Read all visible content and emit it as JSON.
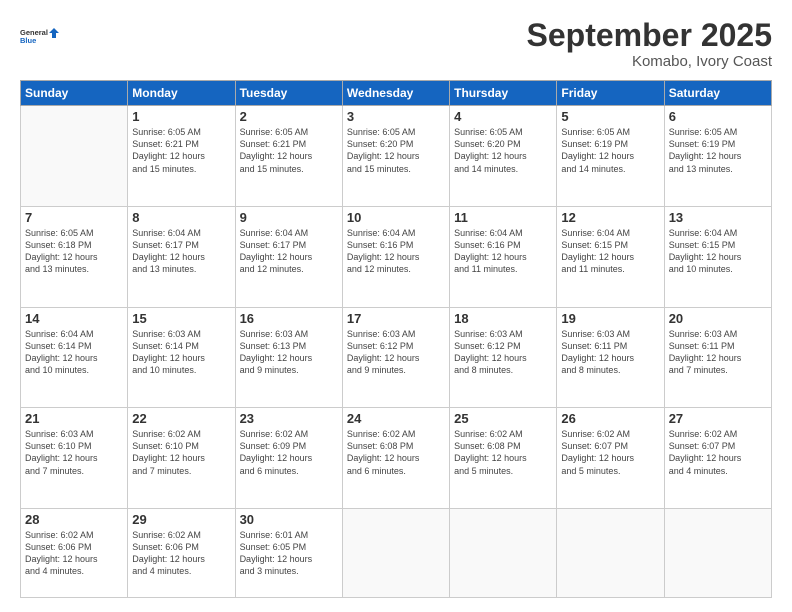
{
  "logo": {
    "line1": "General",
    "line2": "Blue"
  },
  "title": "September 2025",
  "location": "Komabo, Ivory Coast",
  "header_days": [
    "Sunday",
    "Monday",
    "Tuesday",
    "Wednesday",
    "Thursday",
    "Friday",
    "Saturday"
  ],
  "weeks": [
    [
      {
        "day": "",
        "info": ""
      },
      {
        "day": "1",
        "info": "Sunrise: 6:05 AM\nSunset: 6:21 PM\nDaylight: 12 hours\nand 15 minutes."
      },
      {
        "day": "2",
        "info": "Sunrise: 6:05 AM\nSunset: 6:21 PM\nDaylight: 12 hours\nand 15 minutes."
      },
      {
        "day": "3",
        "info": "Sunrise: 6:05 AM\nSunset: 6:20 PM\nDaylight: 12 hours\nand 15 minutes."
      },
      {
        "day": "4",
        "info": "Sunrise: 6:05 AM\nSunset: 6:20 PM\nDaylight: 12 hours\nand 14 minutes."
      },
      {
        "day": "5",
        "info": "Sunrise: 6:05 AM\nSunset: 6:19 PM\nDaylight: 12 hours\nand 14 minutes."
      },
      {
        "day": "6",
        "info": "Sunrise: 6:05 AM\nSunset: 6:19 PM\nDaylight: 12 hours\nand 13 minutes."
      }
    ],
    [
      {
        "day": "7",
        "info": "Sunrise: 6:05 AM\nSunset: 6:18 PM\nDaylight: 12 hours\nand 13 minutes."
      },
      {
        "day": "8",
        "info": "Sunrise: 6:04 AM\nSunset: 6:17 PM\nDaylight: 12 hours\nand 13 minutes."
      },
      {
        "day": "9",
        "info": "Sunrise: 6:04 AM\nSunset: 6:17 PM\nDaylight: 12 hours\nand 12 minutes."
      },
      {
        "day": "10",
        "info": "Sunrise: 6:04 AM\nSunset: 6:16 PM\nDaylight: 12 hours\nand 12 minutes."
      },
      {
        "day": "11",
        "info": "Sunrise: 6:04 AM\nSunset: 6:16 PM\nDaylight: 12 hours\nand 11 minutes."
      },
      {
        "day": "12",
        "info": "Sunrise: 6:04 AM\nSunset: 6:15 PM\nDaylight: 12 hours\nand 11 minutes."
      },
      {
        "day": "13",
        "info": "Sunrise: 6:04 AM\nSunset: 6:15 PM\nDaylight: 12 hours\nand 10 minutes."
      }
    ],
    [
      {
        "day": "14",
        "info": "Sunrise: 6:04 AM\nSunset: 6:14 PM\nDaylight: 12 hours\nand 10 minutes."
      },
      {
        "day": "15",
        "info": "Sunrise: 6:03 AM\nSunset: 6:14 PM\nDaylight: 12 hours\nand 10 minutes."
      },
      {
        "day": "16",
        "info": "Sunrise: 6:03 AM\nSunset: 6:13 PM\nDaylight: 12 hours\nand 9 minutes."
      },
      {
        "day": "17",
        "info": "Sunrise: 6:03 AM\nSunset: 6:12 PM\nDaylight: 12 hours\nand 9 minutes."
      },
      {
        "day": "18",
        "info": "Sunrise: 6:03 AM\nSunset: 6:12 PM\nDaylight: 12 hours\nand 8 minutes."
      },
      {
        "day": "19",
        "info": "Sunrise: 6:03 AM\nSunset: 6:11 PM\nDaylight: 12 hours\nand 8 minutes."
      },
      {
        "day": "20",
        "info": "Sunrise: 6:03 AM\nSunset: 6:11 PM\nDaylight: 12 hours\nand 7 minutes."
      }
    ],
    [
      {
        "day": "21",
        "info": "Sunrise: 6:03 AM\nSunset: 6:10 PM\nDaylight: 12 hours\nand 7 minutes."
      },
      {
        "day": "22",
        "info": "Sunrise: 6:02 AM\nSunset: 6:10 PM\nDaylight: 12 hours\nand 7 minutes."
      },
      {
        "day": "23",
        "info": "Sunrise: 6:02 AM\nSunset: 6:09 PM\nDaylight: 12 hours\nand 6 minutes."
      },
      {
        "day": "24",
        "info": "Sunrise: 6:02 AM\nSunset: 6:08 PM\nDaylight: 12 hours\nand 6 minutes."
      },
      {
        "day": "25",
        "info": "Sunrise: 6:02 AM\nSunset: 6:08 PM\nDaylight: 12 hours\nand 5 minutes."
      },
      {
        "day": "26",
        "info": "Sunrise: 6:02 AM\nSunset: 6:07 PM\nDaylight: 12 hours\nand 5 minutes."
      },
      {
        "day": "27",
        "info": "Sunrise: 6:02 AM\nSunset: 6:07 PM\nDaylight: 12 hours\nand 4 minutes."
      }
    ],
    [
      {
        "day": "28",
        "info": "Sunrise: 6:02 AM\nSunset: 6:06 PM\nDaylight: 12 hours\nand 4 minutes."
      },
      {
        "day": "29",
        "info": "Sunrise: 6:02 AM\nSunset: 6:06 PM\nDaylight: 12 hours\nand 4 minutes."
      },
      {
        "day": "30",
        "info": "Sunrise: 6:01 AM\nSunset: 6:05 PM\nDaylight: 12 hours\nand 3 minutes."
      },
      {
        "day": "",
        "info": ""
      },
      {
        "day": "",
        "info": ""
      },
      {
        "day": "",
        "info": ""
      },
      {
        "day": "",
        "info": ""
      }
    ]
  ]
}
